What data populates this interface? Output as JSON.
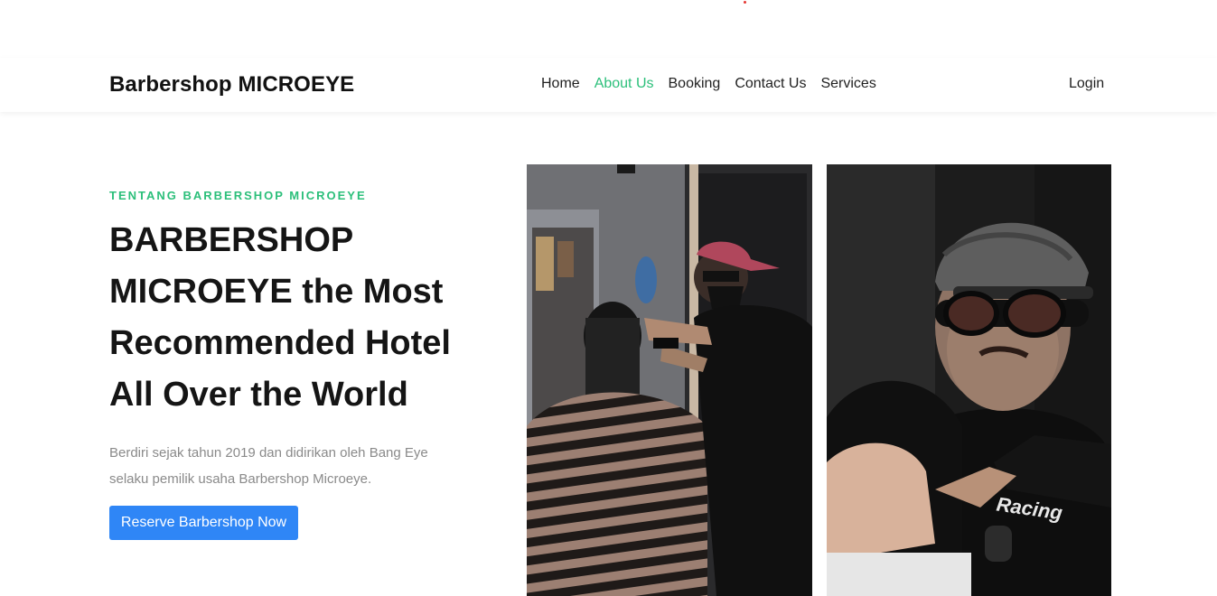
{
  "navbar": {
    "brand": "Barbershop MICROEYE",
    "links": [
      {
        "label": "Home",
        "active": false
      },
      {
        "label": "About Us",
        "active": true
      },
      {
        "label": "Booking",
        "active": false
      },
      {
        "label": "Contact Us",
        "active": false
      },
      {
        "label": "Services",
        "active": false
      }
    ],
    "login": "Login"
  },
  "hero": {
    "eyebrow": "TENTANG BARBERSHOP MICROEYE",
    "headline": "BARBERSHOP MICROEYE the Most Recommended Hotel All Over the World",
    "description": "Berdiri sejak tahun 2019 dan didirikan oleh Bang Eye selaku pemilik usaha Barbershop Microeye.",
    "cta": "Reserve Barbershop Now"
  },
  "photos": [
    {
      "description": "barber cutting customer hair"
    },
    {
      "description": "barber with cap and glasses"
    }
  ],
  "shirt_print": "Racing",
  "colors": {
    "accent": "#2bbf7a",
    "button": "#2f86f6",
    "text": "#151515",
    "muted": "#8a8a8a"
  }
}
